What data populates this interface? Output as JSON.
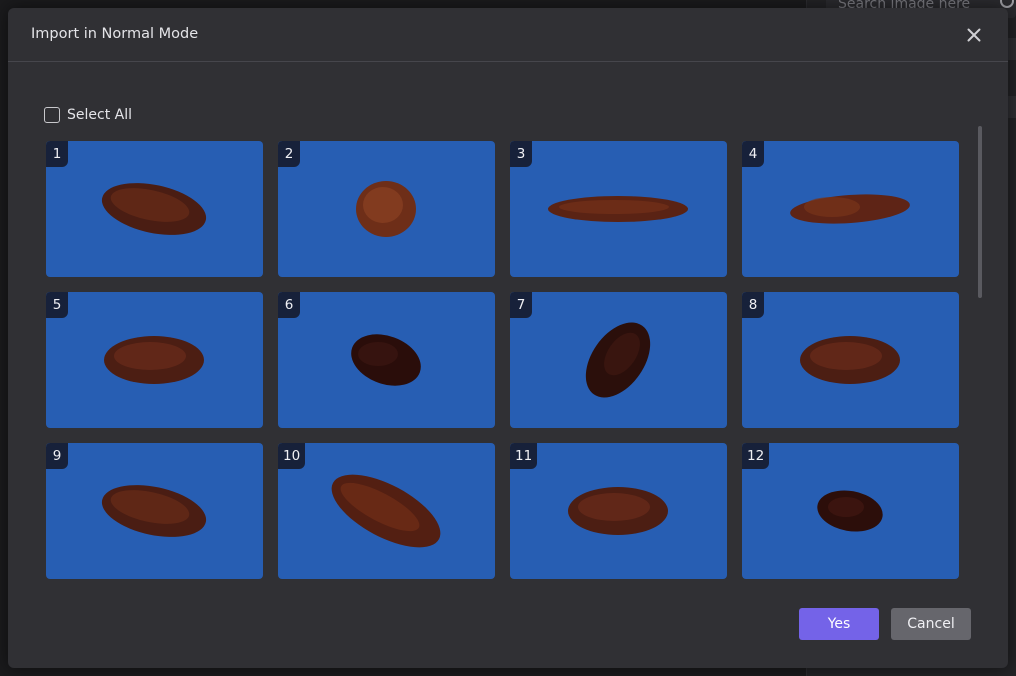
{
  "background": {
    "search_placeholder": "Search image here"
  },
  "dialog": {
    "title": "Import in Normal Mode",
    "select_all_label": "Select All",
    "select_all_checked": false,
    "yes_label": "Yes",
    "cancel_label": "Cancel"
  },
  "images": [
    {
      "number": "1",
      "shape": "raisin-oval-tilted",
      "selected": false
    },
    {
      "number": "2",
      "shape": "raisin-round",
      "selected": false
    },
    {
      "number": "3",
      "shape": "raisin-long-flat",
      "selected": false
    },
    {
      "number": "4",
      "shape": "raisin-flat-lumpy",
      "selected": false
    },
    {
      "number": "5",
      "shape": "raisin-oval",
      "selected": false
    },
    {
      "number": "6",
      "shape": "raisin-dark-wrinkled",
      "selected": false
    },
    {
      "number": "7",
      "shape": "raisin-dark-diagonal",
      "selected": false
    },
    {
      "number": "8",
      "shape": "raisin-oval",
      "selected": false
    },
    {
      "number": "9",
      "shape": "raisin-oval-tilted",
      "selected": false
    },
    {
      "number": "10",
      "shape": "raisin-long-diagonal",
      "selected": false
    },
    {
      "number": "11",
      "shape": "raisin-oval",
      "selected": false
    },
    {
      "number": "12",
      "shape": "raisin-dark-small",
      "selected": false
    }
  ],
  "colors": {
    "tile_background": "#275eb3",
    "accent": "#7463e8",
    "dialog_background": "#303034"
  }
}
